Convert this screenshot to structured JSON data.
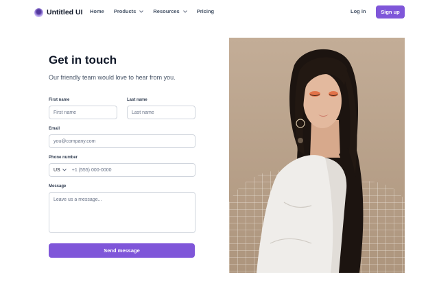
{
  "nav": {
    "brand": "Untitled UI",
    "links": [
      {
        "label": "Home",
        "has_dropdown": false
      },
      {
        "label": "Products",
        "has_dropdown": true
      },
      {
        "label": "Resources",
        "has_dropdown": true
      },
      {
        "label": "Pricing",
        "has_dropdown": false
      }
    ],
    "login": "Log in",
    "signup": "Sign up"
  },
  "form": {
    "title": "Get in touch",
    "subtitle": "Our friendly team would love to hear from you.",
    "first_name": {
      "label": "First name",
      "placeholder": "First name"
    },
    "last_name": {
      "label": "Last name",
      "placeholder": "Last name"
    },
    "email": {
      "label": "Email",
      "placeholder": "you@company.com"
    },
    "phone": {
      "label": "Phone number",
      "country": "US",
      "placeholder": "+1 (555) 000-0000"
    },
    "message": {
      "label": "Message",
      "placeholder": "Leave us a message..."
    },
    "submit": "Send message"
  },
  "colors": {
    "accent": "#7f56d9",
    "heading": "#101828",
    "body_text": "#475467",
    "border": "#d0d5dd",
    "photo_background": "#b9a38e"
  },
  "icons": {
    "logo": "logo-mark-icon",
    "dropdown": "chevron-down-icon"
  }
}
